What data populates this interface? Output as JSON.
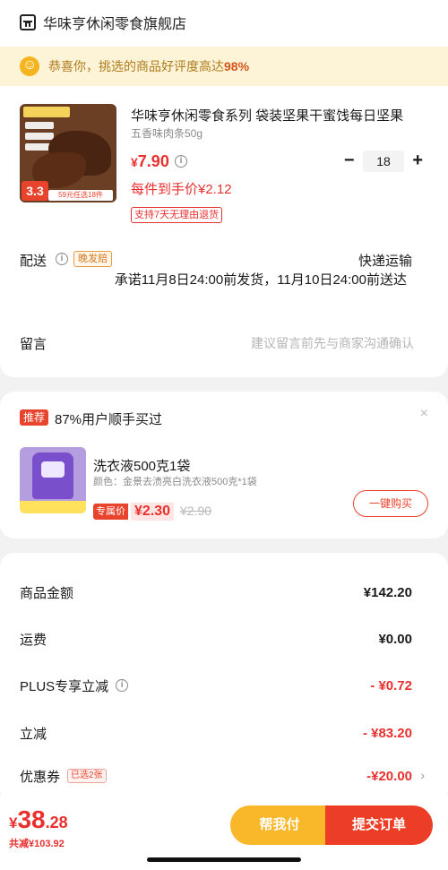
{
  "store": {
    "name": "华味亨休闲零食旗舰店",
    "icon": "store-icon"
  },
  "praise": {
    "prefix": "恭喜你，挑选的商品好评度高达",
    "highlight": "98%"
  },
  "product": {
    "title": "华味亨休闲零食系列 袋装坚果干蜜饯每日坚果",
    "spec": "五香味肉条50g",
    "price_currency": "¥",
    "price": "7.90",
    "unit_price": "每件到手价¥2.12",
    "return_tag": "支持7天无理由退货",
    "quantity": "18",
    "image_badge": "3.3",
    "image_strip": "59元任选18件"
  },
  "delivery": {
    "label": "配送",
    "late_tag": "晚发赔",
    "method": "快递运输",
    "promise": "承诺11月8日24:00前发货，11月10日24:00前送达"
  },
  "message": {
    "label": "留言",
    "placeholder": "建议留言前先与商家沟通确认"
  },
  "recommend": {
    "badge": "推荐",
    "title": "87%用户顺手买过",
    "close": "×",
    "item_name": "洗衣液500克1袋",
    "item_spec": "颜色：金景去渍亮白洗衣液500克*1袋",
    "excl_tag": "专属价",
    "price": "¥2.30",
    "orig_price": "¥2.90",
    "buy_button": "一键购买"
  },
  "summary": {
    "goods_label": "商品金额",
    "goods_value": "¥142.20",
    "shipping_label": "运费",
    "shipping_value": "¥0.00",
    "plus_label": "PLUS专享立减",
    "plus_value": "- ¥0.72",
    "discount_label": "立减",
    "discount_value": "- ¥83.20",
    "coupon_label": "优惠券",
    "coupon_tag": "已选2张",
    "coupon_value": "-¥20.00",
    "chevron": "›"
  },
  "bottom": {
    "currency": "¥",
    "total_int": "38",
    "total_dec": ".28",
    "saved": "共减¥103.92",
    "help_pay": "帮我付",
    "submit": "提交订单"
  },
  "colors": {
    "accent_red": "#e8312f",
    "accent_yellow": "#f9b72a",
    "praise_bg": "#fdf4d7"
  }
}
